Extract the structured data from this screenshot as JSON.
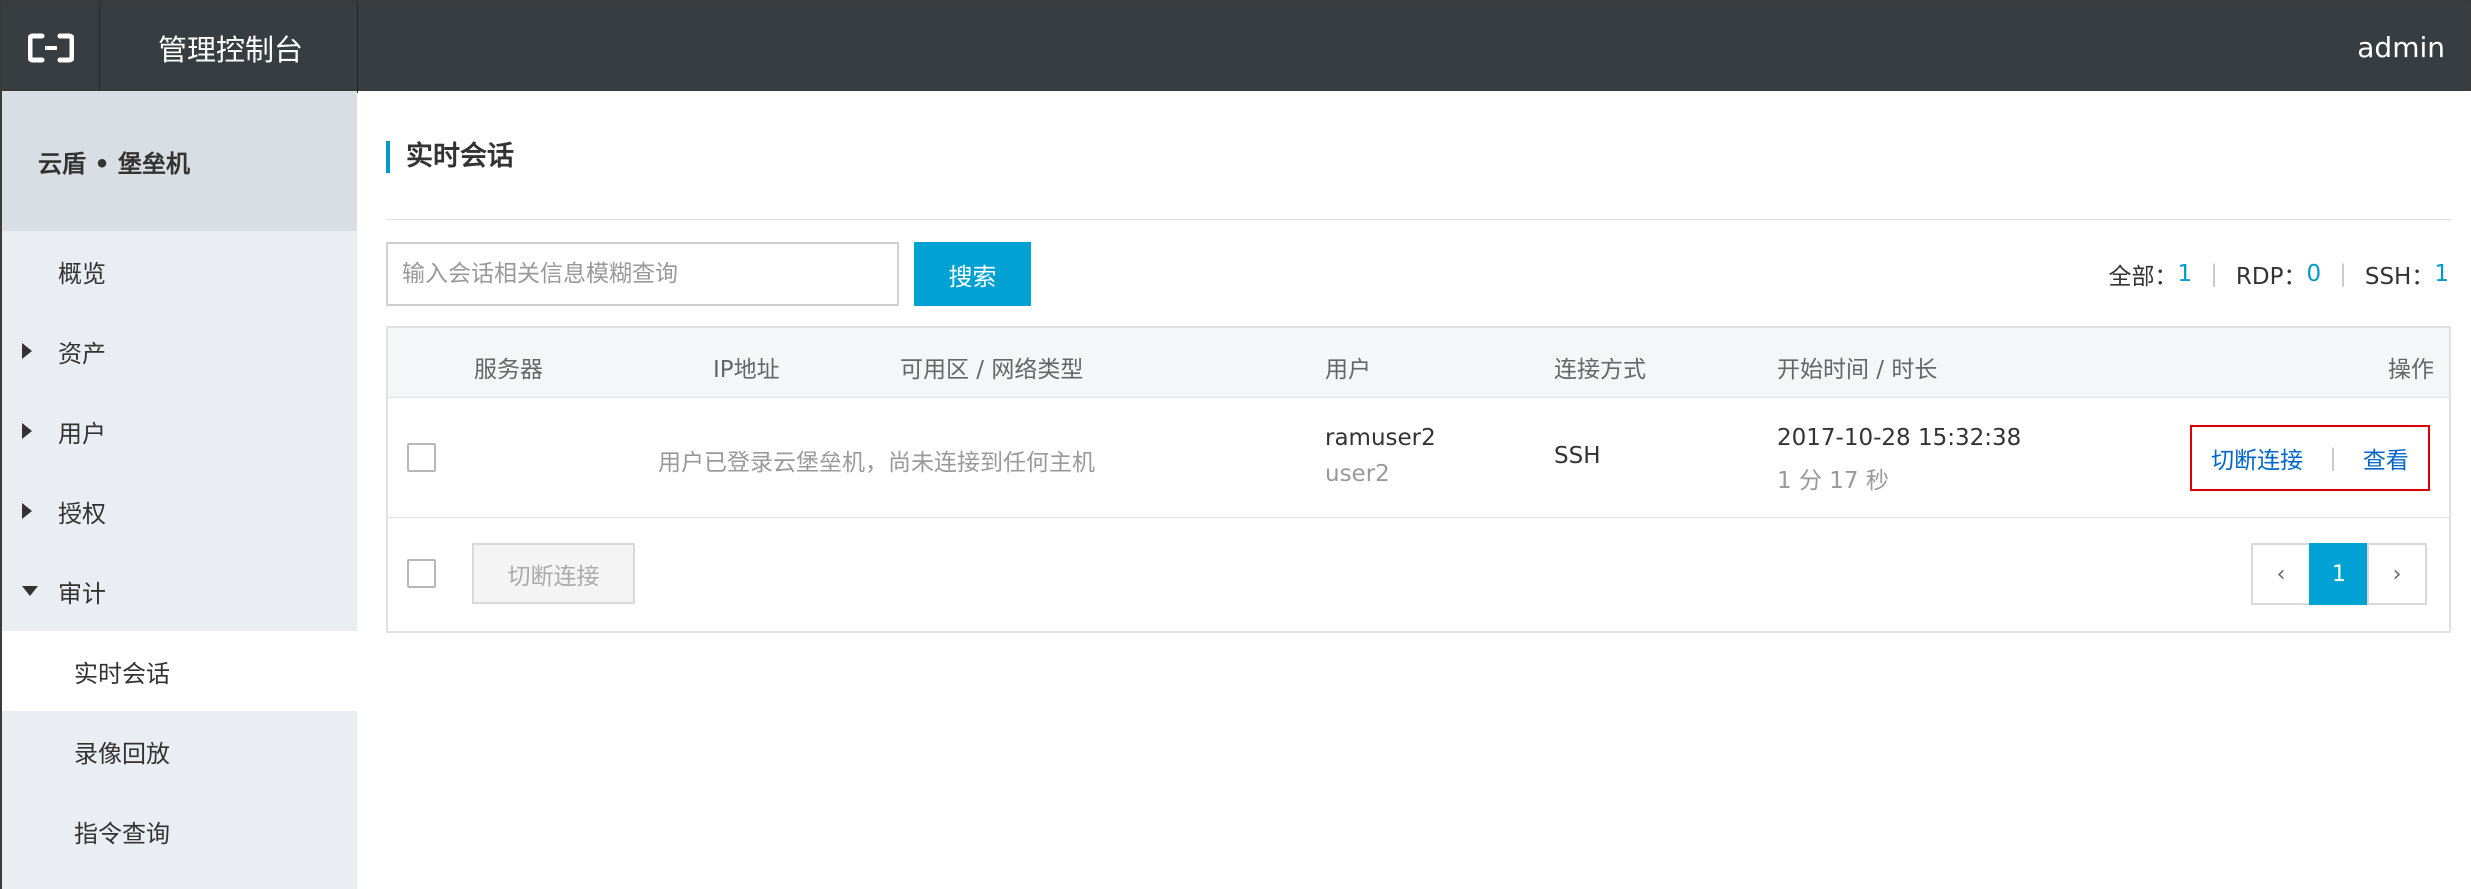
{
  "header": {
    "logo_icon": "aliyun-logo-icon",
    "console_title": "管理控制台",
    "user": "admin"
  },
  "sidebar": {
    "product": "云盾 • 堡垒机",
    "items": [
      {
        "label": "概览",
        "icon": "none"
      },
      {
        "label": "资产",
        "icon": "caret-right-icon"
      },
      {
        "label": "用户",
        "icon": "caret-right-icon"
      },
      {
        "label": "授权",
        "icon": "caret-right-icon"
      },
      {
        "label": "审计",
        "icon": "caret-down-icon"
      }
    ],
    "sub_items": [
      {
        "label": "实时会话",
        "active": true
      },
      {
        "label": "录像回放",
        "active": false
      },
      {
        "label": "指令查询",
        "active": false
      }
    ]
  },
  "main": {
    "title": "实时会话",
    "search": {
      "placeholder": "输入会话相关信息模糊查询",
      "value": "",
      "button": "搜索"
    },
    "stats": {
      "all_label": "全部：",
      "all_count": "1",
      "rdp_label": "RDP：",
      "rdp_count": "0",
      "ssh_label": "SSH：",
      "ssh_count": "1"
    },
    "table": {
      "headers": {
        "server": "服务器",
        "ip": "IP地址",
        "zone": "可用区 / 网络类型",
        "user": "用户",
        "protocol": "连接方式",
        "start": "开始时间 / 时长",
        "ops": "操作"
      },
      "rows": [
        {
          "status_message": "用户已登录云堡垒机，尚未连接到任何主机",
          "user": "ramuser2",
          "user_sub": "user2",
          "protocol": "SSH",
          "start_time": "2017-10-28 15:32:38",
          "duration": "1 分 17 秒",
          "action_disconnect": "切断连接",
          "action_view": "查看"
        }
      ],
      "bulk_action": "切断连接",
      "pagination": {
        "prev": "‹",
        "current": "1",
        "next": "›"
      }
    }
  },
  "colors": {
    "topbar": "#373d41",
    "sidebar": "#eaedf1",
    "accent": "#00a2d4",
    "link": "#0066cc",
    "highlight_border": "#e00000"
  }
}
